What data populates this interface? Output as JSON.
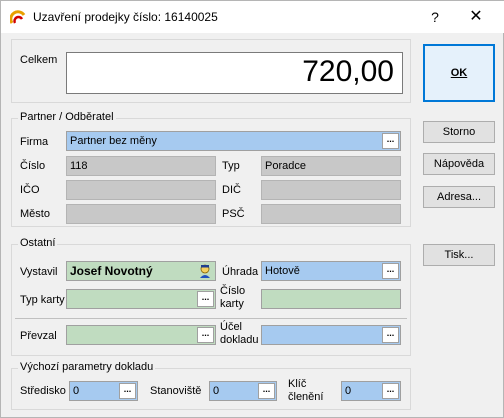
{
  "window": {
    "title": "Uzavření prodejky číslo: 16140025",
    "help_glyph": "?",
    "close_glyph": "✕"
  },
  "total": {
    "label": "Celkem",
    "value": "720,00"
  },
  "partner": {
    "group_title": "Partner / Odběratel",
    "firma_label": "Firma",
    "firma_value": "Partner bez měny",
    "cislo_label": "Číslo",
    "cislo_value": "118",
    "typ_label": "Typ",
    "typ_value": "Poradce",
    "ico_label": "IČO",
    "ico_value": "",
    "dic_label": "DIČ",
    "dic_value": "",
    "mesto_label": "Město",
    "mesto_value": "",
    "psc_label": "PSČ",
    "psc_value": ""
  },
  "ostatni": {
    "group_title": "Ostatní",
    "vystavil_label": "Vystavil",
    "vystavil_value": "Josef Novotný",
    "uhrada_label": "Úhrada",
    "uhrada_value": "Hotově",
    "typ_karty_label": "Typ karty",
    "typ_karty_value": "",
    "cislo_karty_label_1": "Číslo",
    "cislo_karty_label_2": "karty",
    "cislo_karty_value": "",
    "prevzal_label": "Převzal",
    "prevzal_value": "",
    "ucel_label_1": "Účel",
    "ucel_label_2": "dokladu",
    "ucel_value": ""
  },
  "defaults": {
    "group_title": "Výchozí parametry dokladu",
    "stredisko_label": "Středisko",
    "stredisko_value": "0",
    "stanoviste_label": "Stanoviště",
    "stanoviste_value": "0",
    "klic_label_1": "Klíč",
    "klic_label_2": "členění",
    "klic_value": "0"
  },
  "buttons": {
    "ok": "OK",
    "storno": "Storno",
    "napoveda": "Nápověda",
    "adresa": "Adresa...",
    "tisk": "Tisk..."
  },
  "ellipsis": "..."
}
